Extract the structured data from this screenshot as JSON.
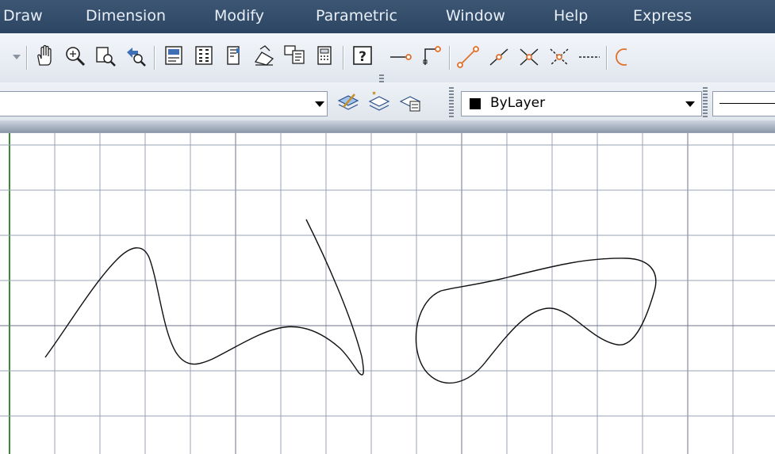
{
  "menubar": {
    "items": [
      "Draw",
      "Dimension",
      "Modify",
      "Parametric",
      "Window",
      "Help",
      "Express"
    ]
  },
  "toolbar1": {
    "icons": [
      "dropdown-arrow-icon",
      "pan-icon",
      "zoom-realtime-icon",
      "zoom-window-icon",
      "zoom-previous-icon",
      "properties-icon",
      "design-center-icon",
      "tool-palettes-icon",
      "markup-icon",
      "sheet-set-icon",
      "calculator-icon",
      "help-icon",
      "snap-endpoint-icon",
      "snap-perpendicular-icon",
      "line-icon",
      "snap-midpoint-icon",
      "snap-intersection-icon",
      "snap-apparent-icon",
      "snap-extension-icon",
      "circle-icon"
    ]
  },
  "toolbar2": {
    "layer_combo_value": "",
    "color_combo_value": "ByLayer",
    "color_swatch": "#000000"
  },
  "canvas": {
    "background": "#ffffff",
    "grid_color": "#9aa0b4",
    "major_grid_color": "#6c7289",
    "axis_color": "#3a8a3a",
    "curve_color": "#111111"
  }
}
